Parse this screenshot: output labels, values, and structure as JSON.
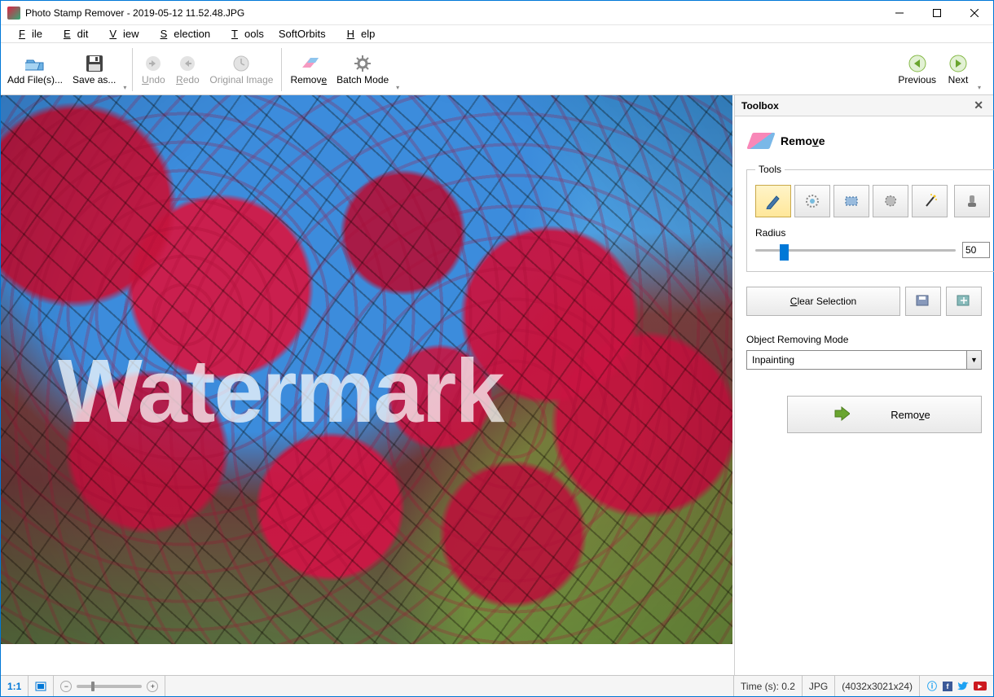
{
  "window": {
    "title": "Photo Stamp Remover - 2019-05-12 11.52.48.JPG"
  },
  "menu": {
    "file": "File",
    "edit": "Edit",
    "view": "View",
    "selection": "Selection",
    "tools": "Tools",
    "softorbits": "SoftOrbits",
    "help": "Help"
  },
  "toolbar": {
    "add_files": "Add File(s)...",
    "save_as": "Save as...",
    "undo": "Undo",
    "redo": "Redo",
    "original": "Original Image",
    "remove": "Remove",
    "batch": "Batch Mode",
    "previous": "Previous",
    "next": "Next"
  },
  "canvas": {
    "watermark_text": "Watermark"
  },
  "sidebar": {
    "header": "Toolbox",
    "panel_title": "Remove",
    "tools_group": "Tools",
    "radius_label": "Radius",
    "radius_value": "50",
    "clear_selection": "Clear Selection",
    "mode_label": "Object Removing Mode",
    "mode_value": "Inpainting",
    "remove_button": "Remove"
  },
  "status": {
    "ratio": "1:1",
    "time": "Time (s): 0.2",
    "format": "JPG",
    "dimensions": "(4032x3021x24)"
  }
}
